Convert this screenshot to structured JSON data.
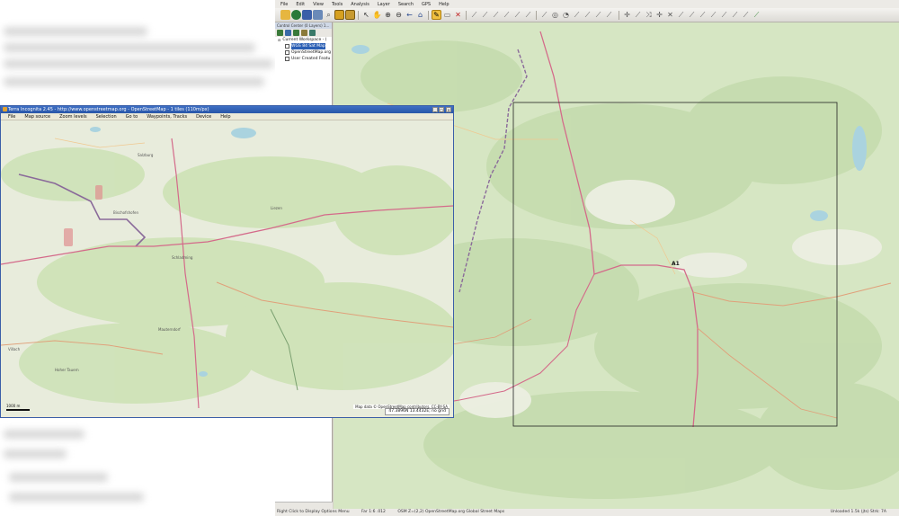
{
  "gm_menu": [
    "File",
    "Edit",
    "View",
    "Tools",
    "Analysis",
    "Layer",
    "Search",
    "GPS",
    "Help"
  ],
  "workspace": {
    "title": "Control Center (0 Layers) 1...",
    "items": [
      {
        "label": "Current Workspace - (",
        "selected": false
      },
      {
        "label": "WGS 84 Sat Map",
        "selected": true
      },
      {
        "label": "OpenStreetMap.org",
        "selected": false
      },
      {
        "label": "User Created Featu",
        "selected": false
      }
    ]
  },
  "gm_map": {
    "frame_label": "A1"
  },
  "gm_status": {
    "hint": "Right Click to Display Options Menu",
    "zoom": "Far 1:6 .012",
    "info": "OSM Z=(2,2) OpenStreetMap.org Global Street Maps",
    "right": "Unloaded 1.5k (jts) Strk: 7A"
  },
  "terra": {
    "title": "Terra Incognita 2.45 - http://www.openstreetmap.org - OpenStreetMap - 1 tiles (110m/px)",
    "menu": [
      "File",
      "Map source",
      "Zoom levels",
      "Selection",
      "Go to",
      "Waypoints, Tracks",
      "Device",
      "Help"
    ],
    "attribution": "Map data © OpenStreetMap contributors, CC-BY-SA",
    "coords": "47.3896N 13.4432E; no grid",
    "scale": "1000 m",
    "places": [
      "Salzburg",
      "Bischofshofen",
      "Liezen",
      "Schladming",
      "Mauterndorf",
      "Hoher Tauern",
      "Villach"
    ]
  },
  "colors": {
    "map_green": "#cfe3b8",
    "map_light": "#ecefe3",
    "road": "#d46a8a",
    "border": "#8a6a9a",
    "water": "#aad3df",
    "accent": "#2b5fb4"
  }
}
